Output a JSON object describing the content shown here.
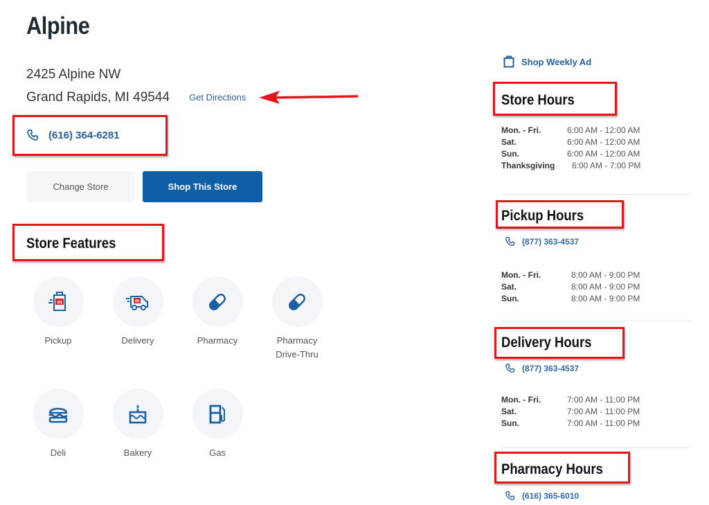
{
  "store": {
    "name": "Alpine",
    "address_line1": "2425 Alpine NW",
    "address_line2": "Grand Rapids, MI 49544",
    "directions_label": "Get Directions",
    "phone": "(616) 364-6281",
    "phone_icon": "phone-icon"
  },
  "actions": {
    "change_store_label": "Change Store",
    "shop_store_label": "Shop This Store"
  },
  "features": {
    "title": "Store Features",
    "items": [
      {
        "label": "Pickup",
        "icon": "pickup-bag-icon"
      },
      {
        "label": "Delivery",
        "icon": "delivery-van-icon"
      },
      {
        "label": "Pharmacy",
        "icon": "pill-icon"
      },
      {
        "label": "Pharmacy Drive-Thru",
        "label_line1": "Pharmacy",
        "label_line2": "Drive-Thru",
        "icon": "pill-icon"
      },
      {
        "label": "Deli",
        "icon": "burger-icon"
      },
      {
        "label": "Bakery",
        "icon": "cake-icon"
      },
      {
        "label": "Gas",
        "icon": "gas-pump-icon"
      }
    ]
  },
  "sidebar": {
    "weekly_ad_label": "Shop Weekly Ad",
    "store_hours": {
      "title": "Store Hours",
      "rows": [
        {
          "day": "Mon. - Fri.",
          "time": "6:00 AM - 12:00 AM"
        },
        {
          "day": "Sat.",
          "time": "6:00 AM - 12:00 AM"
        },
        {
          "day": "Sun.",
          "time": "6:00 AM - 12:00 AM"
        },
        {
          "day": "Thanksgiving",
          "time": "6:00 AM - 7:00 PM"
        }
      ]
    },
    "pickup_hours": {
      "title": "Pickup Hours",
      "phone": "(877) 363-4537",
      "rows": [
        {
          "day": "Mon. - Fri.",
          "time": "8:00 AM - 9:00 PM"
        },
        {
          "day": "Sat.",
          "time": "8:00 AM - 9:00 PM"
        },
        {
          "day": "Sun.",
          "time": "8:00 AM - 9:00 PM"
        }
      ]
    },
    "delivery_hours": {
      "title": "Delivery Hours",
      "phone": "(877) 363-4537",
      "rows": [
        {
          "day": "Mon. - Fri.",
          "time": "7:00 AM - 11:00 PM"
        },
        {
          "day": "Sat.",
          "time": "7:00 AM - 11:00 PM"
        },
        {
          "day": "Sun.",
          "time": "7:00 AM - 11:00 PM"
        }
      ]
    },
    "pharmacy_hours": {
      "title": "Pharmacy Hours",
      "phone": "(616) 365-6010"
    }
  },
  "colors": {
    "brand_blue": "#0f5fa8",
    "link_blue": "#2760a0",
    "annotation_red": "#e3151a",
    "logo_red": "#d7262b"
  }
}
